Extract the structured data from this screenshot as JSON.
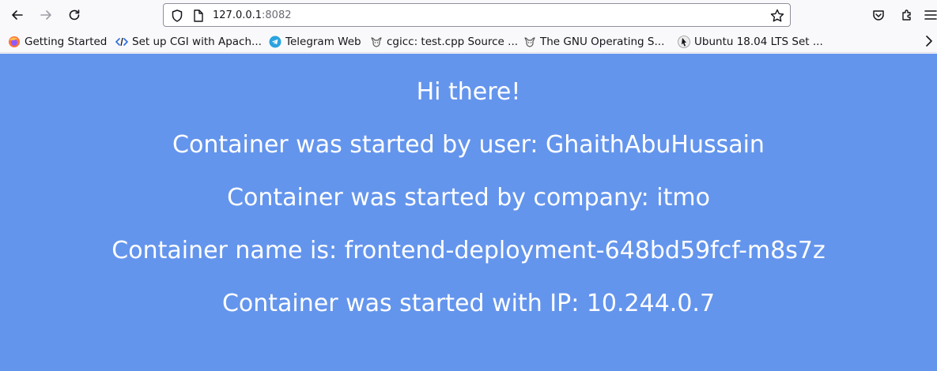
{
  "browser": {
    "url_host": "127.0.0.1",
    "url_port": ":8082",
    "bookmarks": [
      {
        "label": "Getting Started",
        "icon": "firefox-icon"
      },
      {
        "label": "Set up CGI with Apach...",
        "icon": "code-icon"
      },
      {
        "label": "Telegram Web",
        "icon": "telegram-icon"
      },
      {
        "label": "cgicc: test.cpp Source ...",
        "icon": "gnu-icon"
      },
      {
        "label": "The GNU Operating S...",
        "icon": "gnu-icon"
      },
      {
        "label": "Ubuntu 18.04 LTS Set ...",
        "icon": "pointer-icon"
      }
    ]
  },
  "page": {
    "background": "#6495ed",
    "greeting": "Hi there!",
    "started_by_user": "Container was started by user: GhaithAbuHussain",
    "started_by_company": "Container was started by company: itmo",
    "container_name": "Container name is: frontend-deployment-648bd59fcf-m8s7z",
    "container_ip": "Container was started with IP: 10.244.0.7"
  }
}
